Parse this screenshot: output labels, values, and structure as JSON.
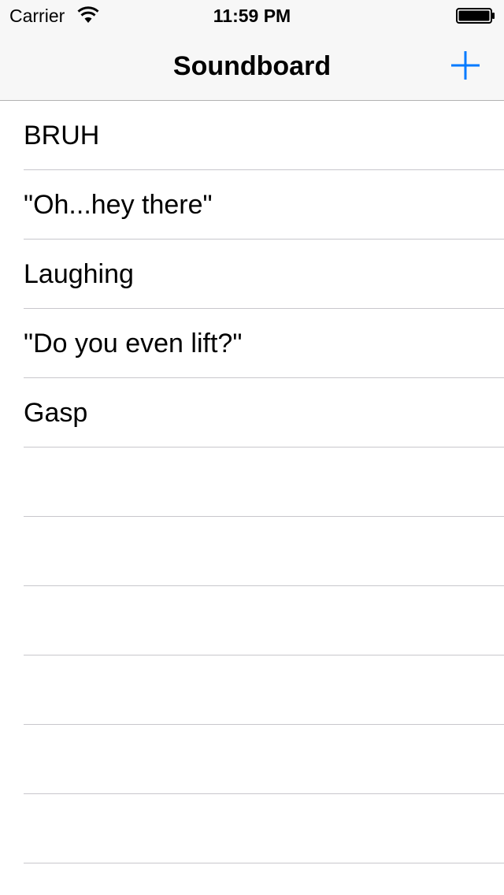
{
  "status_bar": {
    "carrier": "Carrier",
    "time": "11:59 PM",
    "wifi_icon": "wifi-icon",
    "battery_icon": "battery-icon",
    "battery_level": 1.0
  },
  "nav_bar": {
    "title": "Soundboard",
    "add_icon": "plus-icon",
    "accent_color": "#007aff"
  },
  "sounds": [
    {
      "label": "BRUH"
    },
    {
      "label": "\"Oh...hey there\""
    },
    {
      "label": "Laughing"
    },
    {
      "label": "\"Do you even lift?\""
    },
    {
      "label": "Gasp"
    }
  ],
  "colors": {
    "header_background": "#f7f7f7",
    "separator": "#c8c7cc",
    "text": "#000000"
  }
}
